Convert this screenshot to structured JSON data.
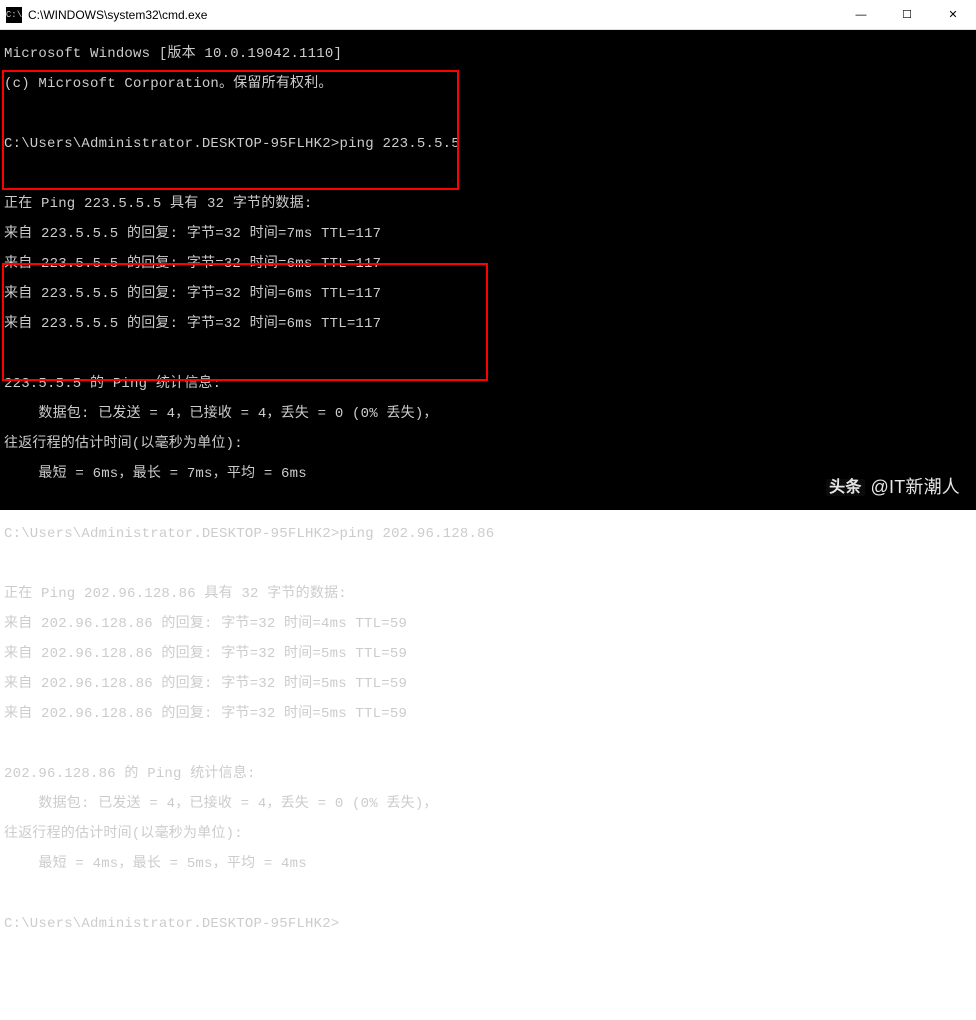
{
  "window": {
    "title": "C:\\WINDOWS\\system32\\cmd.exe",
    "icon_label": "C:\\"
  },
  "controls": {
    "minimize": "—",
    "maximize": "☐",
    "close": "✕"
  },
  "console": {
    "header1": "Microsoft Windows [版本 10.0.19042.1110]",
    "header2": "(c) Microsoft Corporation。保留所有权利。",
    "prompt_path": "C:\\Users\\Administrator.DESKTOP-95FLHK2>",
    "ping1": {
      "cmd": "ping 223.5.5.5",
      "start": "正在 Ping 223.5.5.5 具有 32 字节的数据:",
      "replies": [
        "来自 223.5.5.5 的回复: 字节=32 时间=7ms TTL=117",
        "来自 223.5.5.5 的回复: 字节=32 时间=6ms TTL=117",
        "来自 223.5.5.5 的回复: 字节=32 时间=6ms TTL=117",
        "来自 223.5.5.5 的回复: 字节=32 时间=6ms TTL=117"
      ],
      "stats_header": "223.5.5.5 的 Ping 统计信息:",
      "stats_packets": "    数据包: 已发送 = 4，已接收 = 4，丢失 = 0 (0% 丢失)，",
      "stats_rtt_header": "往返行程的估计时间(以毫秒为单位):",
      "stats_rtt": "    最短 = 6ms，最长 = 7ms，平均 = 6ms"
    },
    "ping2": {
      "cmd": "ping 202.96.128.86",
      "start": "正在 Ping 202.96.128.86 具有 32 字节的数据:",
      "replies": [
        "来自 202.96.128.86 的回复: 字节=32 时间=4ms TTL=59",
        "来自 202.96.128.86 的回复: 字节=32 时间=5ms TTL=59",
        "来自 202.96.128.86 的回复: 字节=32 时间=5ms TTL=59",
        "来自 202.96.128.86 的回复: 字节=32 时间=5ms TTL=59"
      ],
      "stats_header": "202.96.128.86 的 Ping 统计信息:",
      "stats_packets": "    数据包: 已发送 = 4，已接收 = 4，丢失 = 0 (0% 丢失)，",
      "stats_rtt_header": "往返行程的估计时间(以毫秒为单位):",
      "stats_rtt": "    最短 = 4ms，最长 = 5ms，平均 = 4ms"
    },
    "final_prompt": "C:\\Users\\Administrator.DESKTOP-95FLHK2>"
  },
  "watermark": {
    "logo_text": "头条",
    "handle": "@IT新潮人"
  }
}
